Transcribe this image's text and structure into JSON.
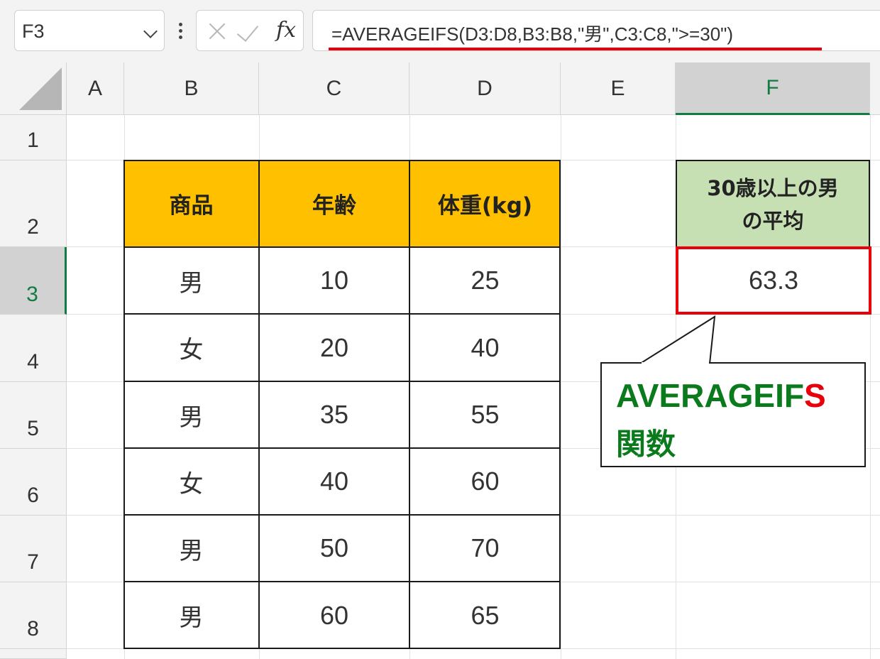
{
  "formula_bar": {
    "name_box": "F3",
    "fx_label": "fx",
    "formula": "=AVERAGEIFS(D3:D8,B3:B8,\"男\",C3:C8,\">=30\")"
  },
  "columns": [
    "A",
    "B",
    "C",
    "D",
    "E",
    "F"
  ],
  "selected_column": "F",
  "rows": [
    "1",
    "2",
    "3",
    "4",
    "5",
    "6",
    "7",
    "8"
  ],
  "selected_row": "3",
  "table": {
    "headers": [
      "商品",
      "年齢",
      "体重(kg)"
    ],
    "rows": [
      [
        "男",
        "10",
        "25"
      ],
      [
        "女",
        "20",
        "40"
      ],
      [
        "男",
        "35",
        "55"
      ],
      [
        "女",
        "40",
        "60"
      ],
      [
        "男",
        "50",
        "70"
      ],
      [
        "男",
        "60",
        "65"
      ]
    ]
  },
  "result": {
    "header_line1": "30歳以上の男",
    "header_line2": "の平均",
    "value": "63.3"
  },
  "callout": {
    "line1_main": "AVERAGEIF",
    "line1_accent": "S",
    "line2": "関数"
  },
  "colors": {
    "header_fill": "#ffc000",
    "result_header_fill": "#c6e0b4",
    "highlight_red": "#e8000b",
    "callout_green": "#0a7a1c",
    "selection_green": "#107c41"
  }
}
